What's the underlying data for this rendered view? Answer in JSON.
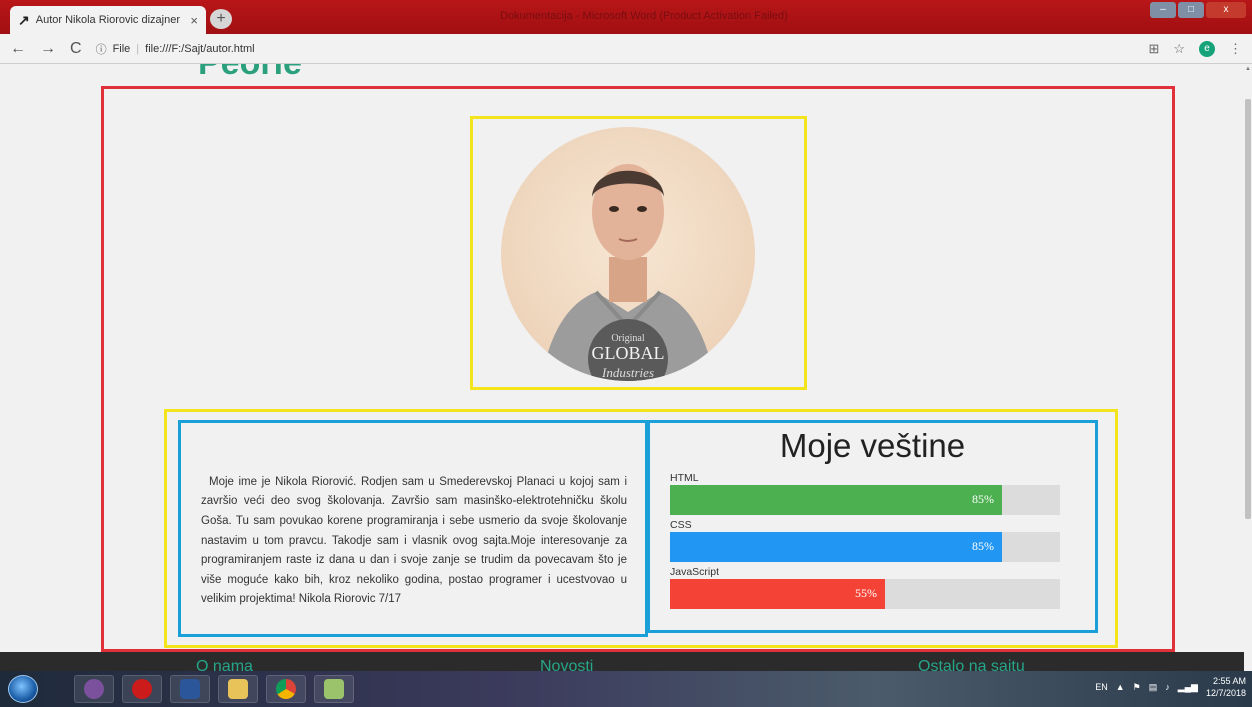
{
  "browser": {
    "tab_title": "Autor Nikola Riorovic dizajner",
    "tab_close": "×",
    "new_tab": "+",
    "window_title_faded": "Dokumentacija - Microsoft Word (Product Activation Failed)",
    "url_info": "ⓘ",
    "url_scheme": "File",
    "url_separator": "|",
    "url": "file:///F:/Sajt/autor.html",
    "nav_back": "←",
    "nav_forward": "→",
    "nav_reload": "C",
    "translate_icon": "⊞",
    "bookmark_icon": "☆",
    "profile_letter": "e",
    "menu_icon": "⋮",
    "window_controls": {
      "minimize": "–",
      "maximize": "□",
      "close": "x"
    }
  },
  "page": {
    "cut_heading": "Peorie",
    "bio_text": "Moje ime je Nikola Riorović. Rodjen sam u Smederevskoj Planaci u kojoj sam i završio veći deo svog školovanja. Završio sam masinško-elektrotehničku školu Goša. Tu sam povukao korene programiranja i sebe usmerio da svoje školovanje nastavim u tom pravcu. Takodje sam i vlasnik ovog sajta.Moje interesovanje za programiranjem raste iz dana u dan i svoje zanje se trudim da povecavam što je više moguće kako bih, kroz nekoliko godina, postao programer i ucestvovao u velikim projektima! Nikola Riorovic 7/17",
    "photo_shirt_text": [
      "Original",
      "GLOBAL",
      "Industries"
    ],
    "skills_title": "Moje veštine",
    "skills": [
      {
        "name": "HTML",
        "percent": 85,
        "label": "85%",
        "color": "#4caf50"
      },
      {
        "name": "CSS",
        "percent": 85,
        "label": "85%",
        "color": "#2196f3"
      },
      {
        "name": "JavaScript",
        "percent": 55,
        "label": "55%",
        "color": "#f44336"
      }
    ],
    "footer_links": [
      "O nama",
      "Novosti",
      "Ostalo na sajtu"
    ]
  },
  "taskbar": {
    "apps": [
      "viber-icon",
      "opera-icon",
      "word-icon",
      "file-explorer-icon",
      "chrome-icon",
      "notepad-icon"
    ],
    "language": "EN",
    "time": "2:55 AM",
    "date": "12/7/2018"
  },
  "colors": {
    "outer_border": "#e0303a",
    "yellow_border": "#f4e41c",
    "blue_border": "#1aa0d8",
    "heading_green": "#2aa07c"
  }
}
